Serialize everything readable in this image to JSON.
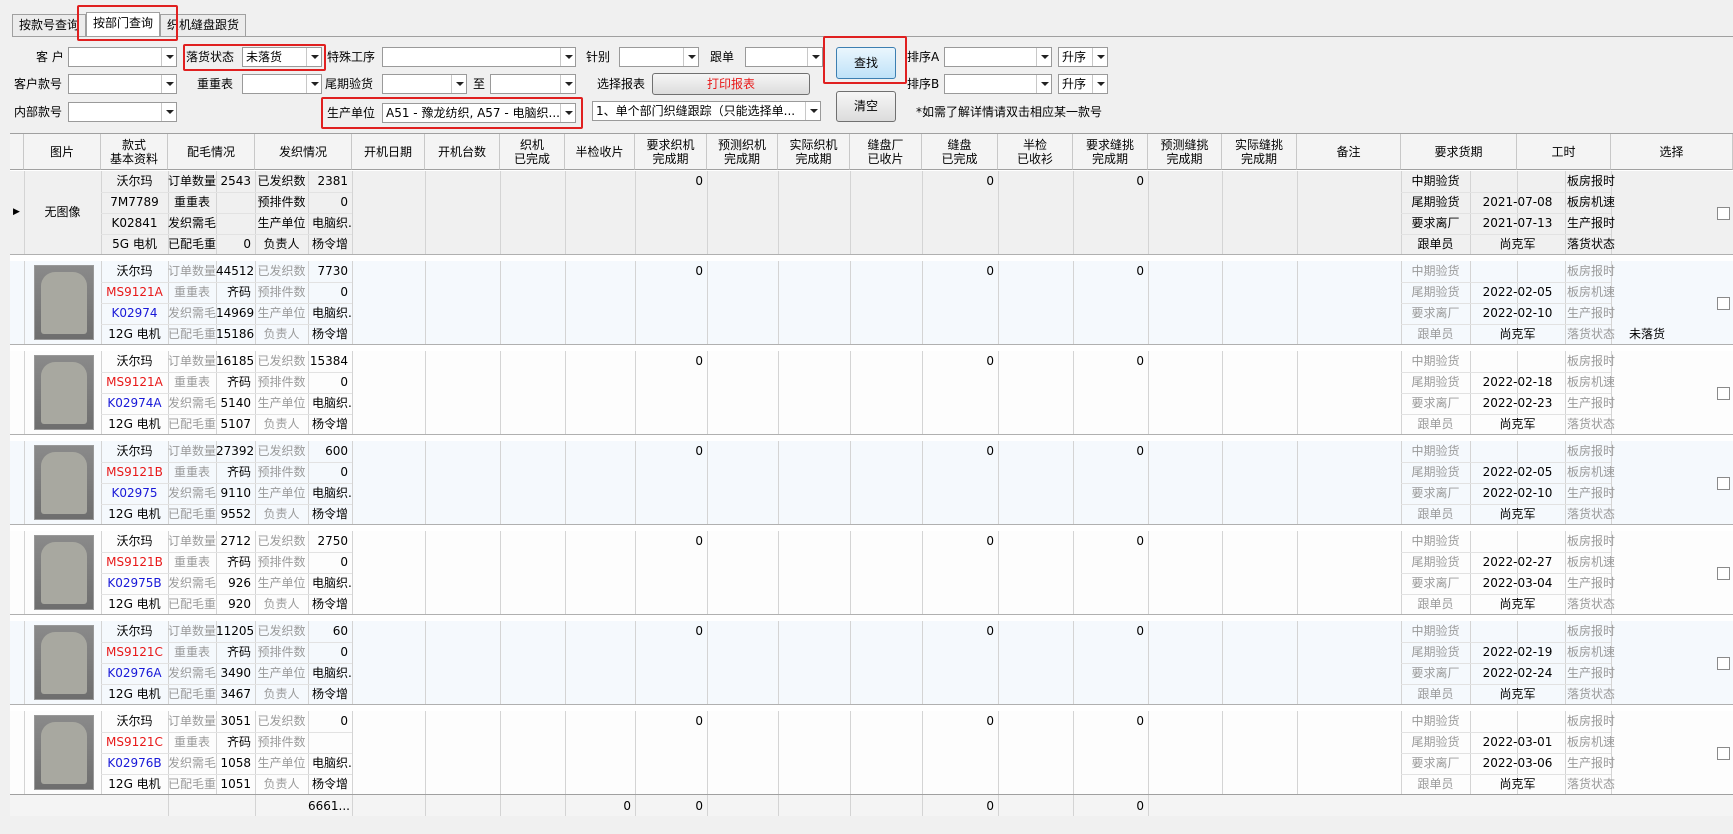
{
  "tabs": [
    {
      "label": "按款号查询"
    },
    {
      "label": "按部门查询"
    },
    {
      "label": "织机缝盘跟货"
    }
  ],
  "filters": {
    "customer_label": "客 户",
    "customer_value": "",
    "cust_style_label": "客户款号",
    "cust_style_value": "",
    "inner_style_label": "内部款号",
    "inner_style_value": "",
    "delivery_status_label": "落货状态",
    "delivery_status_value": "未落货",
    "weight_table_label": "重重表",
    "weight_table_value": "",
    "special_label": "特殊工序",
    "special_value": "",
    "final_inspect_label": "尾期验货",
    "final_inspect_from": "",
    "to_label": "至",
    "final_inspect_to": "",
    "prod_unit_label": "生产单位",
    "prod_unit_value": "A51 - 豫龙纺织, A57 - 电脑织...",
    "needle_label": "针别",
    "needle_value": "",
    "follow_label": "跟单",
    "follow_value": "",
    "report_label": "选择报表",
    "report_value": "1、单个部门织缝跟踪（只能选择单...",
    "print_label": "打印报表",
    "search_label": "查找",
    "clear_label": "清空",
    "sortA_label": "排序A",
    "sortA_value": "",
    "sortA_dir": "升序",
    "sortB_label": "排序B",
    "sortB_value": "",
    "sortB_dir": "升序",
    "hint": "*如需了解详情请双击相应某一款号"
  },
  "columns": [
    {
      "label": "图片"
    },
    {
      "label": "款式\n基本资料"
    },
    {
      "label": "配毛情况"
    },
    {
      "label": "发织情况"
    },
    {
      "label": "开机日期"
    },
    {
      "label": "开机台数"
    },
    {
      "label": "织机\n已完成"
    },
    {
      "label": "半检收片"
    },
    {
      "label": "要求织机\n完成期"
    },
    {
      "label": "预测织机\n完成期"
    },
    {
      "label": "实际织机\n完成期"
    },
    {
      "label": "缝盘厂\n已收片"
    },
    {
      "label": "缝盘\n已完成"
    },
    {
      "label": "半检\n已收衫"
    },
    {
      "label": "要求缝挑\n完成期"
    },
    {
      "label": "预测缝挑\n完成期"
    },
    {
      "label": "实际缝挑\n完成期"
    },
    {
      "label": "备注"
    },
    {
      "label": "要求货期"
    },
    {
      "label": "工时"
    },
    {
      "label": "选择"
    }
  ],
  "field_labels": {
    "order_qty": "订单数量",
    "weight_table": "重重表",
    "knit_need": "发织需毛",
    "issued_wool": "已配毛重",
    "knitted": "已发织数",
    "pre_scheduled": "预排件数",
    "prod_unit": "生产单位",
    "owner": "负责人",
    "mid_inspect": "中期验货",
    "final_inspect": "尾期验货",
    "leave_factory": "要求离厂",
    "merchandiser": "跟单员",
    "sample_report": "板房报时",
    "sample_speed": "板房机速",
    "prod_report": "生产报时",
    "delivery_status": "落货状态"
  },
  "rows": [
    {
      "no_image": "无图像",
      "customer": "沃尔玛",
      "style": "7M7789",
      "inner": "K02841",
      "gauge": "5G 电机",
      "order_qty": "2543",
      "weight_table": "",
      "knit_need": "",
      "issued_wool": "0",
      "knitted": "2381",
      "pre_scheduled": "0",
      "prod_unit": "电脑织...",
      "owner": "杨令增",
      "knit_done": "0",
      "sew_received": "0",
      "half_inspect": "0",
      "final_inspect": "2021-07-08",
      "leave_factory": "2021-07-13",
      "merchandiser": "尚克军",
      "delivery_status": ""
    },
    {
      "customer": "沃尔玛",
      "style": "MS9121A",
      "inner": "K02974",
      "gauge": "12G 电机",
      "order_qty": "44512",
      "weight_table": "齐码",
      "knit_need": "14969",
      "issued_wool": "15186",
      "knitted": "7730",
      "pre_scheduled": "0",
      "prod_unit": "电脑织...",
      "owner": "杨令增",
      "knit_done": "0",
      "sew_received": "0",
      "half_inspect": "0",
      "final_inspect": "2022-02-05",
      "leave_factory": "2022-02-10",
      "merchandiser": "尚克军",
      "delivery_status": "未落货"
    },
    {
      "customer": "沃尔玛",
      "style": "MS9121A",
      "inner": "K02974A",
      "gauge": "12G 电机",
      "order_qty": "16185",
      "weight_table": "齐码",
      "knit_need": "5140",
      "issued_wool": "5107",
      "knitted": "15384",
      "pre_scheduled": "0",
      "prod_unit": "电脑织...",
      "owner": "杨令增",
      "knit_done": "0",
      "sew_received": "0",
      "half_inspect": "0",
      "final_inspect": "2022-02-18",
      "leave_factory": "2022-02-23",
      "merchandiser": "尚克军",
      "delivery_status": ""
    },
    {
      "customer": "沃尔玛",
      "style": "MS9121B",
      "inner": "K02975",
      "gauge": "12G 电机",
      "order_qty": "27392",
      "weight_table": "齐码",
      "knit_need": "9110",
      "issued_wool": "9552",
      "knitted": "600",
      "pre_scheduled": "0",
      "prod_unit": "电脑织...",
      "owner": "杨令增",
      "knit_done": "0",
      "sew_received": "0",
      "half_inspect": "0",
      "final_inspect": "2022-02-05",
      "leave_factory": "2022-02-10",
      "merchandiser": "尚克军",
      "delivery_status": ""
    },
    {
      "customer": "沃尔玛",
      "style": "MS9121B",
      "inner": "K02975B",
      "gauge": "12G 电机",
      "order_qty": "2712",
      "weight_table": "齐码",
      "knit_need": "926",
      "issued_wool": "920",
      "knitted": "2750",
      "pre_scheduled": "0",
      "prod_unit": "电脑织...",
      "owner": "杨令增",
      "knit_done": "0",
      "sew_received": "0",
      "half_inspect": "0",
      "final_inspect": "2022-02-27",
      "leave_factory": "2022-03-04",
      "merchandiser": "尚克军",
      "delivery_status": ""
    },
    {
      "customer": "沃尔玛",
      "style": "MS9121C",
      "inner": "K02976A",
      "gauge": "12G 电机",
      "order_qty": "11205",
      "weight_table": "齐码",
      "knit_need": "3490",
      "issued_wool": "3467",
      "knitted": "60",
      "pre_scheduled": "0",
      "prod_unit": "电脑织...",
      "owner": "杨令增",
      "knit_done": "0",
      "sew_received": "0",
      "half_inspect": "0",
      "final_inspect": "2022-02-19",
      "leave_factory": "2022-02-24",
      "merchandiser": "尚克军",
      "delivery_status": ""
    },
    {
      "customer": "沃尔玛",
      "style": "MS9121C",
      "inner": "K02976B",
      "gauge": "12G 电机",
      "order_qty": "3051",
      "weight_table": "齐码",
      "knit_need": "1058",
      "issued_wool": "1051",
      "knitted": "0",
      "pre_scheduled": "",
      "prod_unit": "电脑织...",
      "owner": "杨令增",
      "knit_done": "0",
      "sew_received": "0",
      "half_inspect": "0",
      "final_inspect": "2022-03-01",
      "leave_factory": "2022-03-06",
      "merchandiser": "尚克军",
      "delivery_status": ""
    }
  ],
  "totals": {
    "knitted": "6661...",
    "knit_done": "0",
    "half_checked": "0",
    "sew_received": "0",
    "half_inspect": "0"
  },
  "colors": {
    "highlight": "#e02020",
    "style_red": "#e81818",
    "inner_blue": "#1818d8"
  }
}
